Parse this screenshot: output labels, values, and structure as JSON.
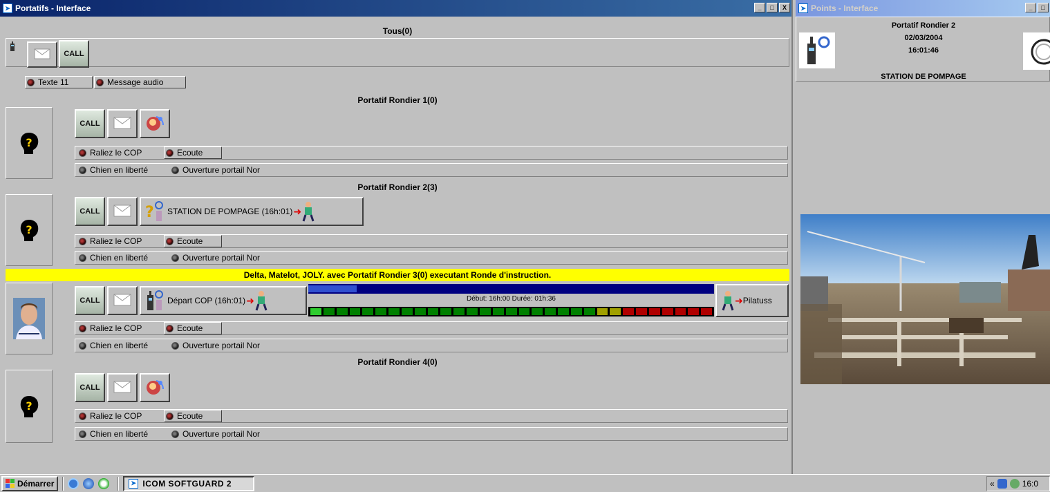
{
  "left_window": {
    "title": "Portatifs - Interface",
    "btn_min": "_",
    "btn_max": "□",
    "btn_close": "X"
  },
  "right_window": {
    "title": "Points - Interface",
    "btn_min": "_",
    "btn_max": "□",
    "portatif": "Portatif Rondier 2",
    "date": "02/03/2004",
    "time": "16:01:46",
    "location": "STATION DE POMPAGE"
  },
  "tous": {
    "header": "Tous(0)",
    "call_label": "CALL",
    "radios": [
      "Texte 11",
      "Message audio"
    ]
  },
  "call_label": "CALL",
  "sections": [
    {
      "header": "Portatif Rondier 1(0)",
      "radios_row1": [
        "Raliez le COP",
        "Ecoute"
      ],
      "radios_row2": [
        "Chien en liberté",
        "Ouverture portail Nor"
      ]
    },
    {
      "header": "Portatif Rondier 2(3)",
      "status": "STATION DE POMPAGE (16h:01)",
      "radios_row1": [
        "Raliez le COP",
        "Ecoute"
      ],
      "radios_row2": [
        "Chien en liberté",
        "Ouverture portail Nor"
      ]
    },
    {
      "header": "Delta, Matelot, JOLY. avec Portatif Rondier 3(0) executant Ronde d'instruction.",
      "status": "Départ COP (16h:01)",
      "progress_label": "Début: 16h:00 Durée: 01h:36",
      "destination": "Pilatuss",
      "progress_fraction": 0.12,
      "radios_row1": [
        "Raliez le COP",
        "Ecoute"
      ],
      "radios_row2": [
        "Chien en liberté",
        "Ouverture portail Nor"
      ]
    },
    {
      "header": "Portatif Rondier 4(0)",
      "radios_row1": [
        "Raliez le COP",
        "Ecoute"
      ],
      "radios_row2": [
        "Chien en liberté",
        "Ouverture portail Nor"
      ]
    }
  ],
  "taskbar": {
    "start": "Démarrer",
    "task": "ICOM SOFTGUARD 2",
    "tray_chevron": "«",
    "clock": "16:0"
  },
  "colors": {
    "title_active": "#0a246a",
    "highlight_header": "#ffff00",
    "segment_green": "#008000",
    "segment_olive": "#a0a000",
    "segment_red": "#b00000"
  }
}
